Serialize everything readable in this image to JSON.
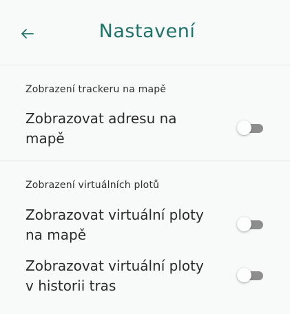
{
  "header": {
    "title": "Nastavení",
    "back_icon": "arrow-left-icon",
    "accent_color": "#1f7368"
  },
  "sections": [
    {
      "label": "Zobrazení trackeru na mapě",
      "items": [
        {
          "label": "Zobrazovat adresu na mapě",
          "enabled": false
        }
      ]
    },
    {
      "label": "Zobrazení virtuálních plotů",
      "items": [
        {
          "label": "Zobrazovat virtuální ploty na mapě",
          "enabled": false
        },
        {
          "label": "Zobrazovat virtuální ploty v historii tras",
          "enabled": false
        }
      ]
    }
  ]
}
